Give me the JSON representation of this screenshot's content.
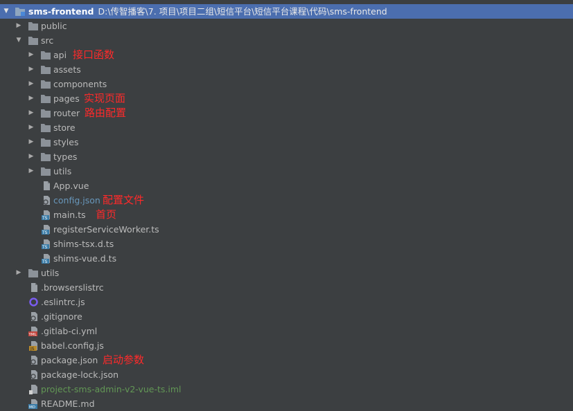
{
  "root": {
    "name": "sms-frontend",
    "path": "D:\\传智播客\\7. 项目\\项目二组\\短信平台\\短信平台课程\\代码\\sms-frontend"
  },
  "tree": [
    {
      "label": "public",
      "icon": "folder-icon",
      "arrow": "collapsed"
    },
    {
      "label": "src",
      "icon": "folder-icon",
      "arrow": "expanded"
    },
    {
      "label": "api",
      "icon": "folder-icon",
      "arrow": "collapsed",
      "note": "接口函数"
    },
    {
      "label": "assets",
      "icon": "folder-icon",
      "arrow": "collapsed"
    },
    {
      "label": "components",
      "icon": "folder-icon",
      "arrow": "collapsed"
    },
    {
      "label": "pages",
      "icon": "folder-icon",
      "arrow": "collapsed",
      "note": "实现页面"
    },
    {
      "label": "router",
      "icon": "folder-icon",
      "arrow": "collapsed",
      "note": "路由配置"
    },
    {
      "label": "store",
      "icon": "folder-icon",
      "arrow": "collapsed"
    },
    {
      "label": "styles",
      "icon": "folder-icon",
      "arrow": "collapsed"
    },
    {
      "label": "types",
      "icon": "folder-icon",
      "arrow": "collapsed"
    },
    {
      "label": "utils",
      "icon": "folder-icon",
      "arrow": "collapsed"
    },
    {
      "label": "App.vue",
      "icon": "file-icon"
    },
    {
      "label": "config.json",
      "icon": "config-file-icon",
      "note": "配置文件",
      "color": "#6897bb"
    },
    {
      "label": "main.ts",
      "icon": "typescript-file-icon",
      "note": "首页"
    },
    {
      "label": "registerServiceWorker.ts",
      "icon": "typescript-file-icon"
    },
    {
      "label": "shims-tsx.d.ts",
      "icon": "typescript-file-icon"
    },
    {
      "label": "shims-vue.d.ts",
      "icon": "typescript-file-icon"
    },
    {
      "label": "utils",
      "icon": "folder-icon",
      "arrow": "collapsed"
    },
    {
      "label": ".browserslistrc",
      "icon": "file-icon"
    },
    {
      "label": ".eslintrc.js",
      "icon": "eslint-icon"
    },
    {
      "label": ".gitignore",
      "icon": "config-file-icon"
    },
    {
      "label": ".gitlab-ci.yml",
      "icon": "yml-file-icon"
    },
    {
      "label": "babel.config.js",
      "icon": "js-file-icon"
    },
    {
      "label": "package.json",
      "icon": "config-file-icon",
      "note": "启动参数"
    },
    {
      "label": "package-lock.json",
      "icon": "config-file-icon"
    },
    {
      "label": "project-sms-admin-v2-vue-ts.iml",
      "icon": "iml-file-icon",
      "color": "#629755"
    },
    {
      "label": "README.md",
      "icon": "markdown-file-icon"
    }
  ],
  "colors": {
    "background": "#3c3f41",
    "selection": "#4b6eaf",
    "annotation": "#ff2a2a",
    "text": "#bbbbbb"
  }
}
